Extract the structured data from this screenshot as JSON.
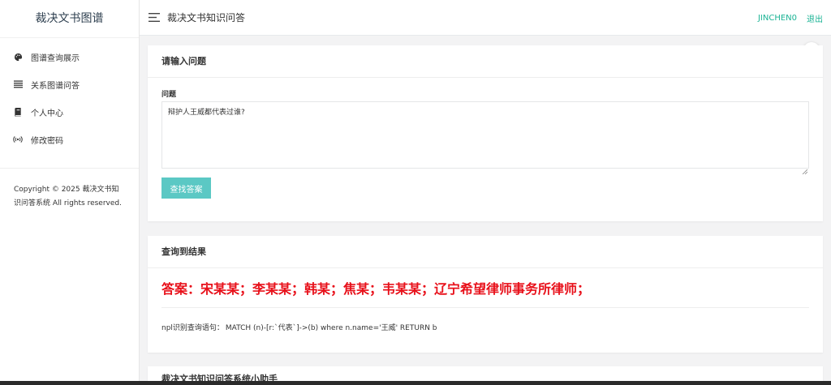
{
  "sidebar": {
    "brand": "裁决文书图谱",
    "items": [
      {
        "label": "图谱查询展示",
        "icon": "palette-icon"
      },
      {
        "label": "关系图谱问答",
        "icon": "list-icon"
      },
      {
        "label": "个人中心",
        "icon": "book-icon"
      },
      {
        "label": "修改密码",
        "icon": "broadcast-icon"
      }
    ],
    "copyright": "Copyright © 2025 裁决文书知识问答系统 All rights reserved."
  },
  "topbar": {
    "title": "裁决文书知识问答",
    "user": "JINCHEN0",
    "logout": "退出"
  },
  "question_card": {
    "title": "请输入问题",
    "field_label": "问题",
    "question_value": "辩护人王威都代表过谁?",
    "button_label": "查找答案"
  },
  "result_card": {
    "title": "查询到结果",
    "answer": "答案：宋某某；李某某；韩某；焦某；韦某某；辽宁希望律师事务所律师；",
    "cypher_label": "npl识别查询语句：",
    "cypher_query": "MATCH (n)-[r:`代表`]->(b) where n.name='王威' RETURN b"
  },
  "assistant_card": {
    "title": "裁决文书知识问答系统小助手"
  },
  "floating_badge": {
    "icon": "extension-badge-icon",
    "glyph": "Y",
    "color": "#3cb371"
  },
  "colors": {
    "accent": "#1ab394",
    "button": "#5bc8c4",
    "answer": "#e8101a"
  }
}
